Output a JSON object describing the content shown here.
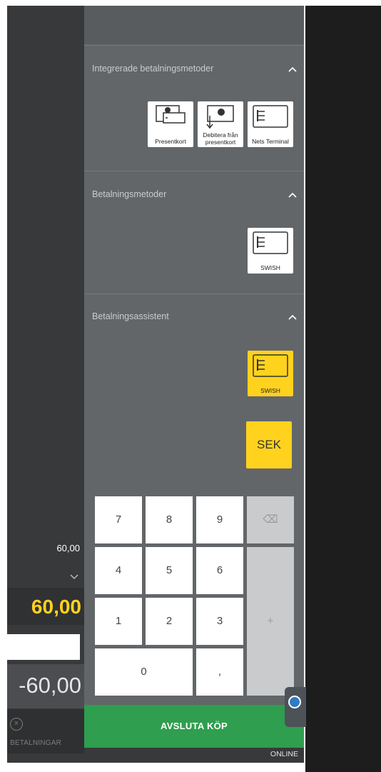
{
  "left_panel": {
    "subtotal": "60,00",
    "total_due": "60,00",
    "balance": "-60,00",
    "payments_label": "BETALNINGAR",
    "close_icon": "close-circle-icon",
    "chevron_icon": "chevron-down-icon"
  },
  "sections": {
    "integrated": {
      "title": "Integrerade betalningsmetoder",
      "tiles": [
        {
          "label": "Presentkort",
          "icon": "gift-card-icon"
        },
        {
          "label_line1": "Debitera från",
          "label_line2": "presentkort",
          "icon": "gift-card-debit-icon"
        },
        {
          "label": "Nets Terminal",
          "icon": "payment-card-icon"
        }
      ]
    },
    "methods": {
      "title": "Betalningsmetoder",
      "tiles": [
        {
          "label": "SWISH",
          "icon": "payment-card-icon"
        }
      ]
    },
    "assistant": {
      "title": "Betalningsassistent",
      "tiles": [
        {
          "label": "SWISH",
          "icon": "payment-card-icon",
          "selected": true
        }
      ],
      "currency_button": "SEK"
    }
  },
  "keypad": {
    "keys": [
      "7",
      "8",
      "9",
      "4",
      "5",
      "6",
      "1",
      "2",
      "3",
      "0",
      ","
    ],
    "backspace": "⌫",
    "plus": "+"
  },
  "finish_button": "AVSLUTA KÖP",
  "status": "ONLINE",
  "colors": {
    "accent_yellow": "#ffd21e",
    "finish_green": "#2f9e4f",
    "panel_gray": "#636669"
  }
}
